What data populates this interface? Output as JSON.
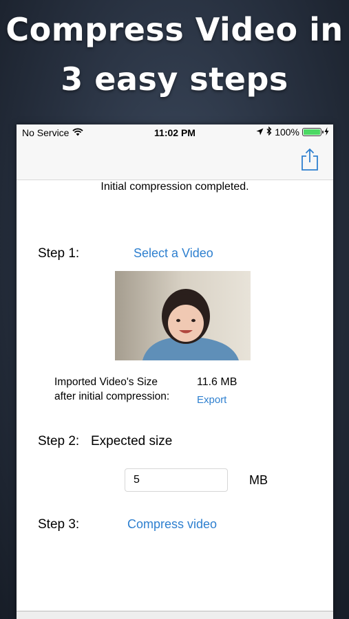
{
  "promo": {
    "line1": "Compress Video in",
    "line2": "3 easy steps"
  },
  "status_bar": {
    "carrier": "No Service",
    "time": "11:02 PM",
    "battery": "100%",
    "battery_level": 1.0,
    "icons": [
      "wifi-icon",
      "location-arrow-icon",
      "bluetooth-icon",
      "battery-icon",
      "charging-bolt-icon"
    ]
  },
  "nav": {
    "share_icon": "share-icon"
  },
  "main": {
    "status_message": "Initial compression completed.",
    "step1_label": "Step 1:",
    "select_video": "Select a Video",
    "video_size_label_line1": "Imported Video's Size",
    "video_size_label_line2": "after initial compression:",
    "video_size_value": "11.6 MB",
    "export_label": "Export",
    "step2_label": "Step 2:",
    "expected_size_label": "Expected size",
    "expected_size_value": "5",
    "size_unit": "MB",
    "step3_label": "Step 3:",
    "compress_button": "Compress video"
  },
  "colors": {
    "link": "#2d7fcf",
    "background": "#27303f",
    "battery": "#4cd964"
  }
}
